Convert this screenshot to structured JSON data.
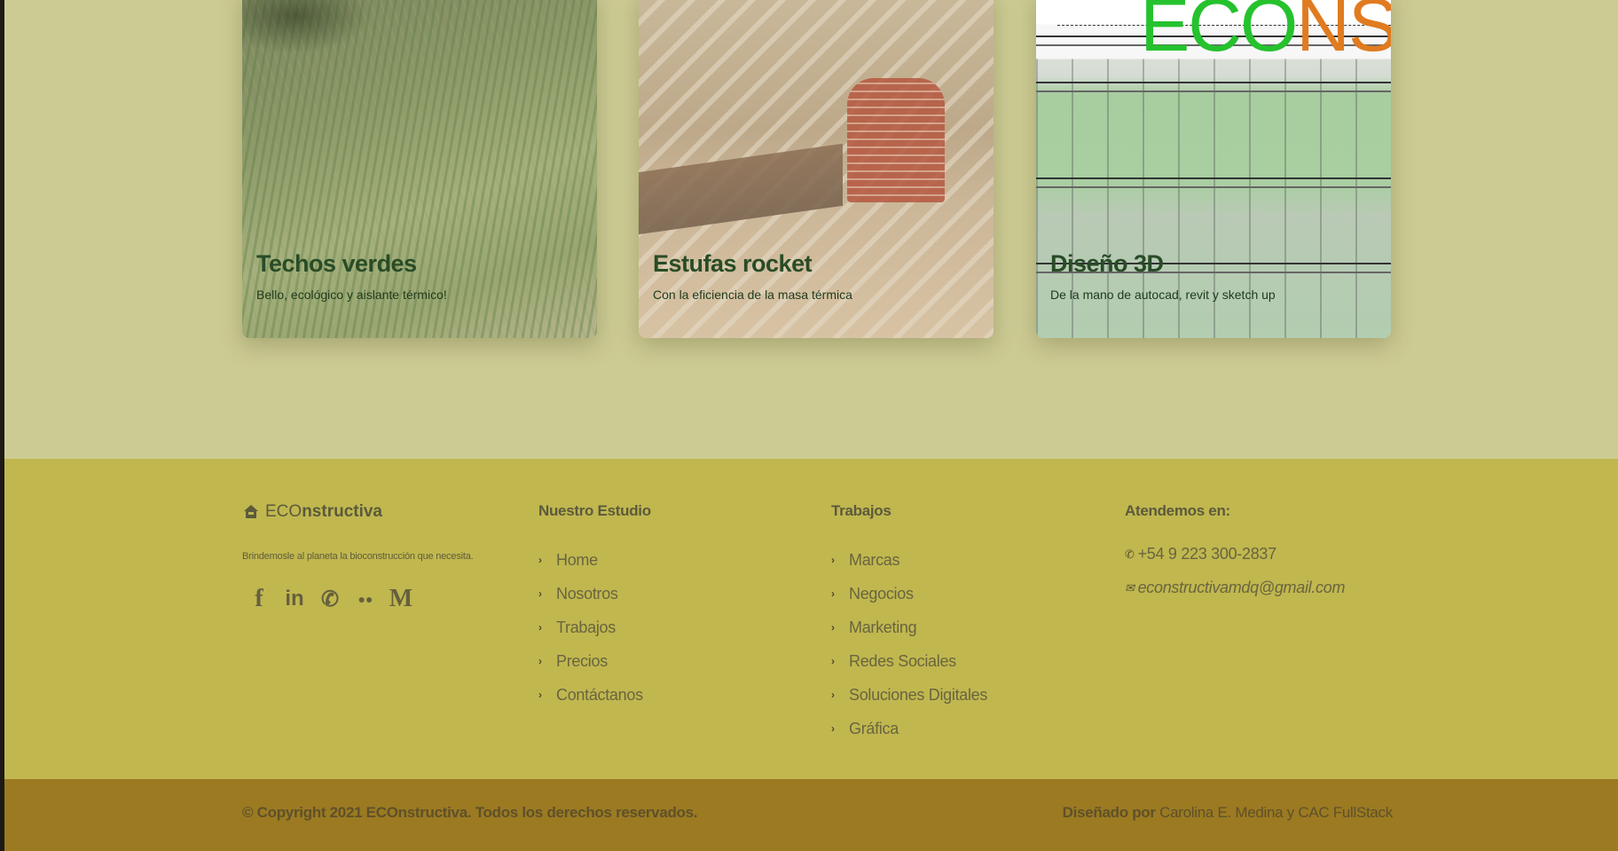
{
  "cards": [
    {
      "title": "Techos verdes",
      "subtitle": "Bello, ecológico y aislante térmico!"
    },
    {
      "title": "Estufas rocket",
      "subtitle": "Con la eficiencia de la masa térmica"
    },
    {
      "title": "Diseño 3D",
      "subtitle": "De la mano de autocad, revit y sketch up"
    }
  ],
  "card3_logo": {
    "green": "ECO",
    "orange": "NS"
  },
  "brand": {
    "prefix": "ECO",
    "suffix": "nstructiva",
    "icon": "home-icon"
  },
  "tagline": "Brindemosle al planeta la bioconstrucción que necesita.",
  "social": [
    {
      "name": "facebook-icon",
      "glyph": "f"
    },
    {
      "name": "linkedin-icon",
      "glyph": "in"
    },
    {
      "name": "whatsapp-icon",
      "glyph": "✆"
    },
    {
      "name": "flickr-icon",
      "glyph": "●●"
    },
    {
      "name": "medium-icon",
      "glyph": "M"
    }
  ],
  "studio": {
    "title": "Nuestro Estudio",
    "links": [
      "Home",
      "Nosotros",
      "Trabajos",
      "Precios",
      "Contáctanos"
    ]
  },
  "works": {
    "title": "Trabajos",
    "links": [
      "Marcas",
      "Negocios",
      "Marketing",
      "Redes Sociales",
      "Soluciones Digitales",
      "Gráfica"
    ]
  },
  "contact": {
    "title": "Atendemos en:",
    "phone": "+54 9 223 300-2837",
    "email": "econstructivamdq@gmail.com"
  },
  "footer_bar": {
    "copyright": "© Copyright 2021 ECOnstructiva. Todos los derechos reservados.",
    "designed_prefix": "Diseñado por",
    "designed_by": "Carolina E. Medina y CAC FullStack"
  },
  "colors": {
    "cards_bg": "#cdcb94",
    "footer_bg": "#c1b74f",
    "bottom_bar_bg": "#9b7a22",
    "card_title": "#284c26"
  }
}
